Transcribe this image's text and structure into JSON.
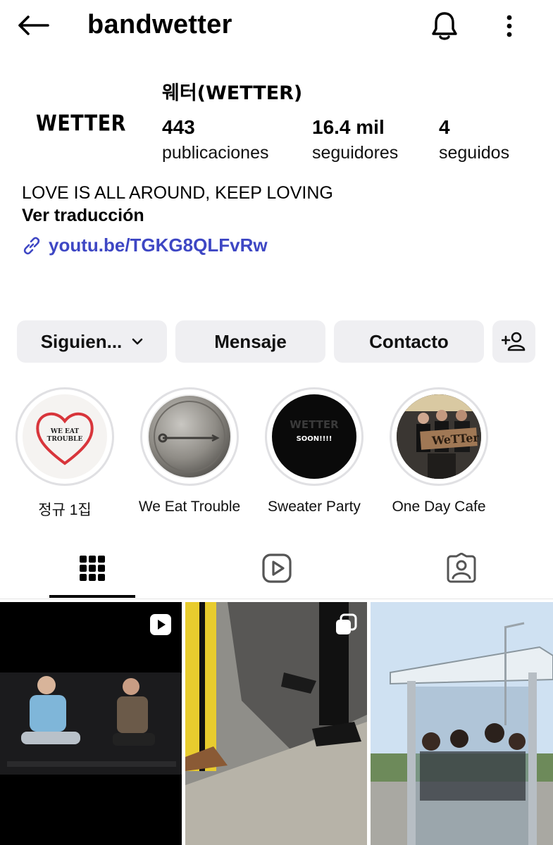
{
  "header": {
    "username": "bandwetter",
    "back_icon": "arrow-left-icon",
    "bell_icon": "bell-icon",
    "more_icon": "more-vertical-icon"
  },
  "profile": {
    "avatar_text": "WETTER",
    "display_name": "웨터(WETTER)",
    "stats": {
      "posts_value": "443",
      "posts_label": "publicaciones",
      "followers_value": "16.4 mil",
      "followers_label": "seguidores",
      "following_value": "4",
      "following_label": "seguidos"
    },
    "bio": "LOVE IS ALL AROUND, KEEP LOVING",
    "translate_label": "Ver traducción",
    "link_text": "youtu.be/TGKG8QLFvRw",
    "link_color": "#3e47c4"
  },
  "actions": {
    "following_label": "Siguien...",
    "message_label": "Mensaje",
    "contact_label": "Contacto",
    "add_user_icon": "add-user-icon"
  },
  "highlights": [
    {
      "label": "정규 1집",
      "cover_text": "WE EAT TROUBLE"
    },
    {
      "label": "We Eat Trouble"
    },
    {
      "label": "Sweater Party",
      "cover_text_top": "WETTER",
      "cover_text_bottom": "SOON!!!!"
    },
    {
      "label": "One Day Cafe",
      "cover_sign": "WeTTer"
    }
  ],
  "tabs": [
    {
      "name": "posts",
      "icon": "grid-icon",
      "active": true
    },
    {
      "name": "reels",
      "icon": "reels-icon",
      "active": false
    },
    {
      "name": "tagged",
      "icon": "tagged-person-icon",
      "active": false
    }
  ],
  "posts": [
    {
      "type": "reel",
      "badge_icon": "reel-play-icon"
    },
    {
      "type": "carousel",
      "badge_icon": "carousel-icon"
    },
    {
      "type": "photo"
    }
  ]
}
